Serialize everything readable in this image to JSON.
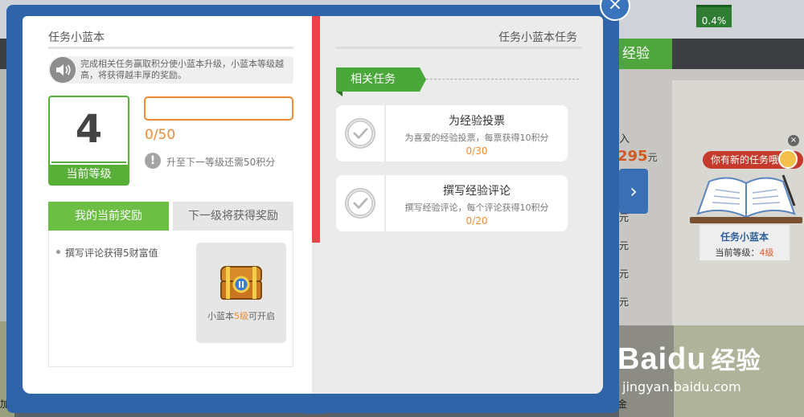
{
  "background": {
    "progress_percent": "0.4%",
    "green_tab_label": "经验",
    "income_label": "入",
    "income_amount": "295",
    "income_unit": "元",
    "yuan_items": [
      "元",
      "元",
      "元",
      "元"
    ],
    "next_arrow": "›",
    "footer_left": "加",
    "footer_right": "金",
    "notice": {
      "bubble": "你有新的任务哦!",
      "title": "任务小蓝本",
      "level_prefix": "当前等级：",
      "level_value": "4级",
      "close": "×"
    },
    "watermark": {
      "logo": "Baidu",
      "logo_suffix": "经验",
      "url": "jingyan.baidu.com"
    }
  },
  "modal": {
    "close_label": "×",
    "left_page": {
      "title": "任务小蓝本",
      "intro": "完成相关任务赢取积分使小蓝本升级，小蓝本等级越高，将获得越丰厚的奖励。",
      "level_number": "4",
      "level_label": "当前等级",
      "progress": {
        "fraction": 0,
        "text": "0/50"
      },
      "upgrade_hint_icon": "!",
      "upgrade_hint": "升至下一等级还需50积分",
      "tabs": [
        "我的当前奖励",
        "下一级将获得奖励"
      ],
      "current_rewards": [
        "撰写评论获得5财富值"
      ],
      "next_reward": {
        "caption_prefix": "小蓝本",
        "caption_level": "5级",
        "caption_suffix": "可开启"
      }
    },
    "right_page": {
      "title": "任务小蓝本任务",
      "section_label": "相关任务",
      "tasks": [
        {
          "title": "为经验投票",
          "desc": "为喜爱的经验投票，每票获得10积分",
          "count": "0/30"
        },
        {
          "title": "撰写经验评论",
          "desc": "撰写经验评论，每个评论获得10积分",
          "count": "0/20"
        }
      ]
    }
  },
  "colors": {
    "book_blue": "#2f65a8",
    "green": "#58b038",
    "orange": "#f08a30",
    "red_band": "#e8434a"
  }
}
